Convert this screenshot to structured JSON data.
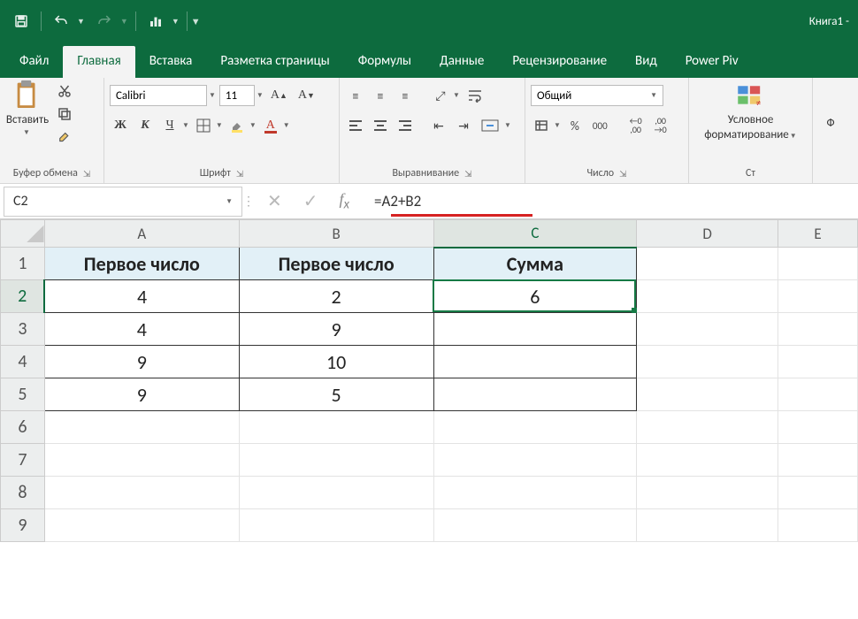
{
  "titlebar": {
    "book": "Книга1 -"
  },
  "tabs": {
    "file": "Файл",
    "home": "Главная",
    "insert": "Вставка",
    "layout": "Разметка страницы",
    "formulas": "Формулы",
    "data": "Данные",
    "review": "Рецензирование",
    "view": "Вид",
    "powerpivot": "Power Piv"
  },
  "ribbon": {
    "clipboard": {
      "label": "Буфер обмена",
      "paste": "Вставить"
    },
    "font": {
      "label": "Шрифт",
      "name": "Calibri",
      "size": "11",
      "bold": "Ж",
      "italic": "К",
      "under": "Ч"
    },
    "align": {
      "label": "Выравнивание"
    },
    "number": {
      "label": "Число",
      "format": "Общий"
    },
    "cond": {
      "label1": "Условное",
      "label2": "форматирование"
    },
    "styles": {
      "label": "Ст"
    },
    "f_label": "Ф"
  },
  "fbar": {
    "namebox": "C2",
    "formula": "=A2+B2"
  },
  "columns": [
    "A",
    "B",
    "C",
    "D",
    "E"
  ],
  "rows": [
    "1",
    "2",
    "3",
    "4",
    "5",
    "6",
    "7",
    "8",
    "9"
  ],
  "active": {
    "row": 2,
    "col": "C"
  },
  "cells": {
    "headers": {
      "A1": "Первое число",
      "B1": "Первое число",
      "C1": "Сумма"
    },
    "A2": "4",
    "B2": "2",
    "C2": "6",
    "A3": "4",
    "B3": "9",
    "A4": "9",
    "B4": "10",
    "A5": "9",
    "B5": "5"
  }
}
